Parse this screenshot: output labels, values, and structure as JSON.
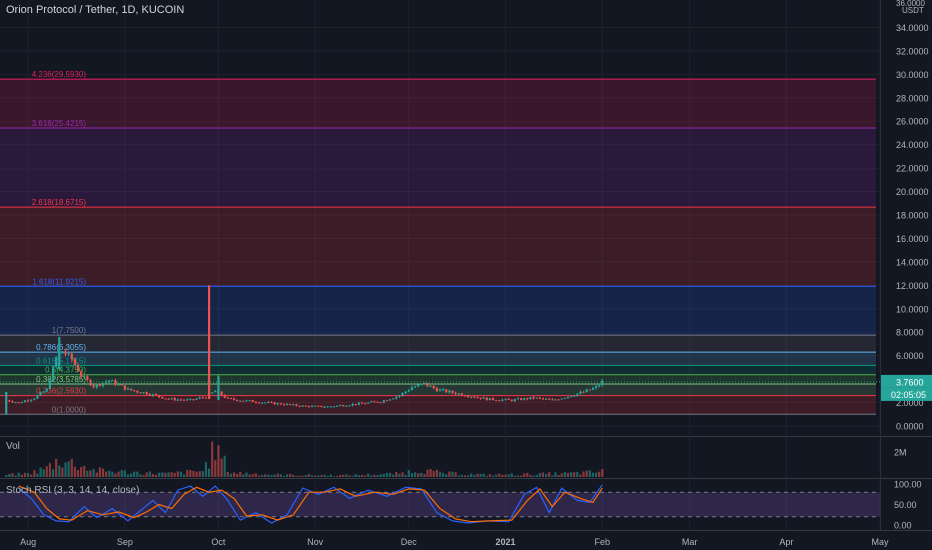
{
  "header": {
    "title": "Orion Protocol / Tether, 1D, KUCOIN"
  },
  "price_axis": {
    "unit": "USDT",
    "top_label": "36.0000",
    "ticks": [
      "34.0000",
      "32.0000",
      "30.0000",
      "28.0000",
      "26.0000",
      "24.0000",
      "22.0000",
      "20.0000",
      "18.0000",
      "16.0000",
      "14.0000",
      "12.0000",
      "10.0000",
      "8.0000",
      "6.0000",
      "4.0000",
      "2.0000",
      "0.0000"
    ],
    "last_price": "3.7600",
    "countdown": "02:05:05"
  },
  "volume_pane": {
    "label": "Vol",
    "axis_label": "2M"
  },
  "rsi_pane": {
    "label": "Stoch RSI (3, 3, 14, 14, close)",
    "ticks": [
      "100.00",
      "50.00",
      "0.00"
    ]
  },
  "x_axis": {
    "labels": [
      "Aug",
      "Sep",
      "Oct",
      "Nov",
      "Dec",
      "2021",
      "Feb",
      "Mar",
      "Apr",
      "May"
    ]
  },
  "colors": {
    "background": "#131722",
    "up": "#26a69a",
    "down": "#ef5350",
    "last_price_tag": "#26a69a",
    "countdown_tag": "#26a69a",
    "rsi_k": "#2962ff",
    "rsi_d": "#ff6d00",
    "rsi_band": "#7e57c2"
  },
  "chart_data": {
    "type": "candlestick",
    "title": "Orion Protocol / Tether, 1D, KUCOIN",
    "yunit": "USDT",
    "ylim": [
      0,
      36
    ],
    "x_range": [
      "2020-07-23",
      "2021-05-01"
    ],
    "grid": true,
    "fib_levels": [
      {
        "label": "0(1.0000)",
        "ratio": 0,
        "price": 1.0,
        "color": "#787b86"
      },
      {
        "label": "0.236(2.5930)",
        "ratio": 0.236,
        "price": 2.593,
        "color": "#f23645"
      },
      {
        "label": "0.382(3.5785)",
        "ratio": 0.382,
        "price": 3.5785,
        "color": "#81c784"
      },
      {
        "label": "0.5(4.3750)",
        "ratio": 0.5,
        "price": 4.375,
        "color": "#4caf50"
      },
      {
        "label": "0.618(5.1715)",
        "ratio": 0.618,
        "price": 5.1715,
        "color": "#089981"
      },
      {
        "label": "0.786(6.3055)",
        "ratio": 0.786,
        "price": 6.3055,
        "color": "#64b5f6"
      },
      {
        "label": "1(7.7500)",
        "ratio": 1,
        "price": 7.75,
        "color": "#787b86"
      },
      {
        "label": "1.618(11.9215)",
        "ratio": 1.618,
        "price": 11.9215,
        "color": "#2962ff"
      },
      {
        "label": "2.618(18.6715)",
        "ratio": 2.618,
        "price": 18.6715,
        "color": "#f23645"
      },
      {
        "label": "3.618(25.4215)",
        "ratio": 3.618,
        "price": 25.4215,
        "color": "#9c27b0"
      },
      {
        "label": "4.236(29.5930)",
        "ratio": 4.236,
        "price": 29.593,
        "color": "#e91e63"
      }
    ],
    "price_path": [
      [
        "2020-07-25",
        2.2
      ],
      [
        "2020-07-29",
        2.0
      ],
      [
        "2020-08-03",
        2.4
      ],
      [
        "2020-08-07",
        3.1
      ],
      [
        "2020-08-10",
        5.8
      ],
      [
        "2020-08-12",
        6.4
      ],
      [
        "2020-08-15",
        5.7
      ],
      [
        "2020-08-18",
        4.3
      ],
      [
        "2020-08-22",
        3.4
      ],
      [
        "2020-08-27",
        3.9
      ],
      [
        "2020-09-02",
        3.1
      ],
      [
        "2020-09-08",
        2.8
      ],
      [
        "2020-09-15",
        2.3
      ],
      [
        "2020-09-22",
        2.2
      ],
      [
        "2020-09-27",
        2.5
      ],
      [
        "2020-09-30",
        3.0
      ],
      [
        "2020-10-04",
        2.3
      ],
      [
        "2020-10-12",
        2.1
      ],
      [
        "2020-10-20",
        1.9
      ],
      [
        "2020-10-28",
        1.7
      ],
      [
        "2020-11-05",
        1.65
      ],
      [
        "2020-11-15",
        1.9
      ],
      [
        "2020-11-22",
        2.1
      ],
      [
        "2020-11-28",
        2.6
      ],
      [
        "2020-12-02",
        3.3
      ],
      [
        "2020-12-06",
        3.6
      ],
      [
        "2020-12-10",
        3.1
      ],
      [
        "2020-12-18",
        2.7
      ],
      [
        "2020-12-26",
        2.3
      ],
      [
        "2021-01-03",
        2.2
      ],
      [
        "2021-01-10",
        2.4
      ],
      [
        "2021-01-16",
        2.2
      ],
      [
        "2021-01-22",
        2.6
      ],
      [
        "2021-01-26",
        2.9
      ],
      [
        "2021-01-30",
        3.3
      ],
      [
        "2021-02-01",
        3.76
      ]
    ],
    "spikes": [
      {
        "date": "2020-07-25",
        "high": 2.9,
        "low": 1.0
      },
      {
        "date": "2020-09-28",
        "high": 12.0,
        "low": 2.3
      },
      {
        "date": "2020-08-11",
        "high": 7.6,
        "low": 4.8
      },
      {
        "date": "2020-10-01",
        "high": 4.3,
        "low": 2.2
      }
    ],
    "volume_path": [
      [
        "2020-07-25",
        0.2
      ],
      [
        "2020-08-01",
        0.3
      ],
      [
        "2020-08-07",
        0.8
      ],
      [
        "2020-08-11",
        1.55
      ],
      [
        "2020-08-16",
        1.2
      ],
      [
        "2020-08-22",
        0.6
      ],
      [
        "2020-09-01",
        0.45
      ],
      [
        "2020-09-15",
        0.3
      ],
      [
        "2020-09-26",
        0.55
      ],
      [
        "2020-09-30",
        2.6
      ],
      [
        "2020-10-05",
        0.4
      ],
      [
        "2020-10-20",
        0.2
      ],
      [
        "2020-11-10",
        0.15
      ],
      [
        "2020-11-28",
        0.3
      ],
      [
        "2020-12-04",
        0.65
      ],
      [
        "2020-12-12",
        0.35
      ],
      [
        "2020-12-25",
        0.2
      ],
      [
        "2021-01-10",
        0.25
      ],
      [
        "2021-01-25",
        0.35
      ],
      [
        "2021-02-01",
        0.5
      ]
    ],
    "volume_ylim": [
      0,
      3
    ],
    "stoch_rsi": {
      "ylim": [
        0,
        100
      ],
      "bands": [
        20,
        80
      ],
      "series": [
        {
          "values": [
            [
              "2020-07-29",
              90
            ],
            [
              "2020-08-02",
              65
            ],
            [
              "2020-08-06",
              25
            ],
            [
              "2020-08-10",
              10
            ],
            [
              "2020-08-14",
              8
            ],
            [
              "2020-08-19",
              45
            ],
            [
              "2020-08-23",
              18
            ],
            [
              "2020-08-28",
              40
            ],
            [
              "2020-09-02",
              10
            ],
            [
              "2020-09-06",
              35
            ],
            [
              "2020-09-10",
              60
            ],
            [
              "2020-09-14",
              30
            ],
            [
              "2020-09-18",
              85
            ],
            [
              "2020-09-22",
              95
            ],
            [
              "2020-09-26",
              70
            ],
            [
              "2020-09-30",
              95
            ],
            [
              "2020-10-04",
              60
            ],
            [
              "2020-10-08",
              12
            ],
            [
              "2020-10-13",
              30
            ],
            [
              "2020-10-18",
              5
            ],
            [
              "2020-10-23",
              25
            ],
            [
              "2020-10-28",
              90
            ],
            [
              "2020-11-02",
              75
            ],
            [
              "2020-11-07",
              92
            ],
            [
              "2020-11-12",
              65
            ],
            [
              "2020-11-18",
              85
            ],
            [
              "2020-11-24",
              70
            ],
            [
              "2020-11-30",
              92
            ],
            [
              "2020-12-05",
              88
            ],
            [
              "2020-12-10",
              30
            ],
            [
              "2020-12-15",
              10
            ],
            [
              "2020-12-20",
              5
            ],
            [
              "2020-12-26",
              10
            ],
            [
              "2021-01-02",
              8
            ],
            [
              "2021-01-07",
              75
            ],
            [
              "2021-01-11",
              92
            ],
            [
              "2021-01-15",
              30
            ],
            [
              "2021-01-19",
              90
            ],
            [
              "2021-01-24",
              60
            ],
            [
              "2021-01-28",
              55
            ],
            [
              "2021-02-01",
              98
            ]
          ]
        },
        {
          "values": [
            [
              "2020-07-29",
              95
            ],
            [
              "2020-08-03",
              80
            ],
            [
              "2020-08-07",
              40
            ],
            [
              "2020-08-11",
              15
            ],
            [
              "2020-08-15",
              12
            ],
            [
              "2020-08-20",
              35
            ],
            [
              "2020-08-25",
              25
            ],
            [
              "2020-08-30",
              32
            ],
            [
              "2020-09-04",
              18
            ],
            [
              "2020-09-08",
              32
            ],
            [
              "2020-09-12",
              50
            ],
            [
              "2020-09-16",
              40
            ],
            [
              "2020-09-20",
              75
            ],
            [
              "2020-09-24",
              92
            ],
            [
              "2020-09-28",
              80
            ],
            [
              "2020-10-02",
              85
            ],
            [
              "2020-10-06",
              65
            ],
            [
              "2020-10-10",
              22
            ],
            [
              "2020-10-15",
              25
            ],
            [
              "2020-10-20",
              12
            ],
            [
              "2020-10-25",
              25
            ],
            [
              "2020-10-30",
              80
            ],
            [
              "2020-11-04",
              80
            ],
            [
              "2020-11-09",
              88
            ],
            [
              "2020-11-14",
              70
            ],
            [
              "2020-11-20",
              80
            ],
            [
              "2020-11-26",
              75
            ],
            [
              "2020-12-01",
              88
            ],
            [
              "2020-12-06",
              85
            ],
            [
              "2020-12-11",
              40
            ],
            [
              "2020-12-16",
              15
            ],
            [
              "2020-12-21",
              8
            ],
            [
              "2020-12-27",
              10
            ],
            [
              "2021-01-03",
              12
            ],
            [
              "2021-01-08",
              60
            ],
            [
              "2021-01-12",
              88
            ],
            [
              "2021-01-16",
              45
            ],
            [
              "2021-01-20",
              80
            ],
            [
              "2021-01-25",
              65
            ],
            [
              "2021-01-29",
              55
            ],
            [
              "2021-02-01",
              90
            ]
          ]
        }
      ]
    }
  }
}
